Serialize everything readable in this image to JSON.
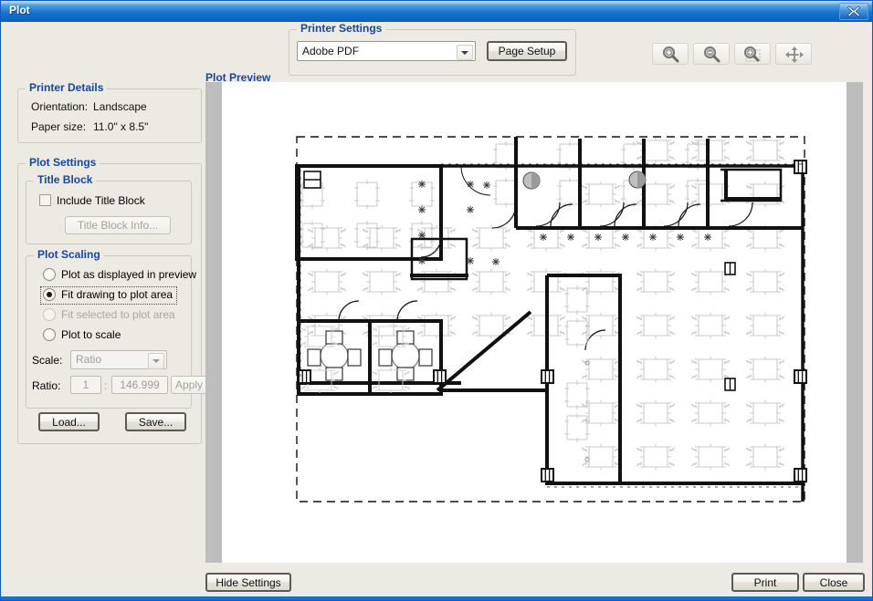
{
  "window": {
    "title": "Plot",
    "close_icon": "close-icon"
  },
  "printer_settings": {
    "legend": "Printer Settings",
    "printer_selected": "Adobe PDF",
    "page_setup_label": "Page Setup"
  },
  "toolbar": {
    "buttons": [
      {
        "name": "zoom-in-icon",
        "label": "Zoom In"
      },
      {
        "name": "zoom-out-icon",
        "label": "Zoom Out"
      },
      {
        "name": "zoom-window-icon",
        "label": "Zoom Window"
      },
      {
        "name": "pan-icon",
        "label": "Pan"
      }
    ]
  },
  "printer_details": {
    "legend": "Printer Details",
    "orientation_label": "Orientation:",
    "orientation_value": "Landscape",
    "paper_size_label": "Paper size:",
    "paper_size_value": "11.0\" x 8.5\""
  },
  "plot_settings": {
    "legend": "Plot Settings",
    "title_block": {
      "legend": "Title Block",
      "include_label": "Include Title Block",
      "include_checked": false,
      "info_button_label": "Title Block Info...",
      "info_button_enabled": false
    },
    "plot_scaling": {
      "legend": "Plot Scaling",
      "options": [
        {
          "label": "Plot as displayed in preview",
          "selected": false,
          "enabled": true,
          "focused": false
        },
        {
          "label": "Fit drawing to plot area",
          "selected": true,
          "enabled": true,
          "focused": true
        },
        {
          "label": "Fit selected to plot area",
          "selected": false,
          "enabled": false,
          "focused": false
        },
        {
          "label": "Plot to scale",
          "selected": false,
          "enabled": true,
          "focused": false
        }
      ],
      "scale_label": "Scale:",
      "scale_value": "Ratio",
      "scale_enabled": false,
      "ratio_label": "Ratio:",
      "ratio_numerator": "1",
      "ratio_separator": ":",
      "ratio_denominator": "146.999",
      "apply_label": "Apply",
      "apply_enabled": false
    },
    "load_label": "Load...",
    "save_label": "Save..."
  },
  "preview": {
    "label": "Plot Preview",
    "drawing_type": "architectural-floor-plan",
    "page_boundary": "dashed"
  },
  "footer": {
    "hide_settings_label": "Hide Settings",
    "print_label": "Print",
    "close_label": "Close"
  },
  "colors": {
    "title_bar": "#1372ce",
    "group_legend": "#15479e",
    "dialog_bg": "#eceae3",
    "preview_bg": "#bdbdbd",
    "page_bg": "#ffffff"
  }
}
